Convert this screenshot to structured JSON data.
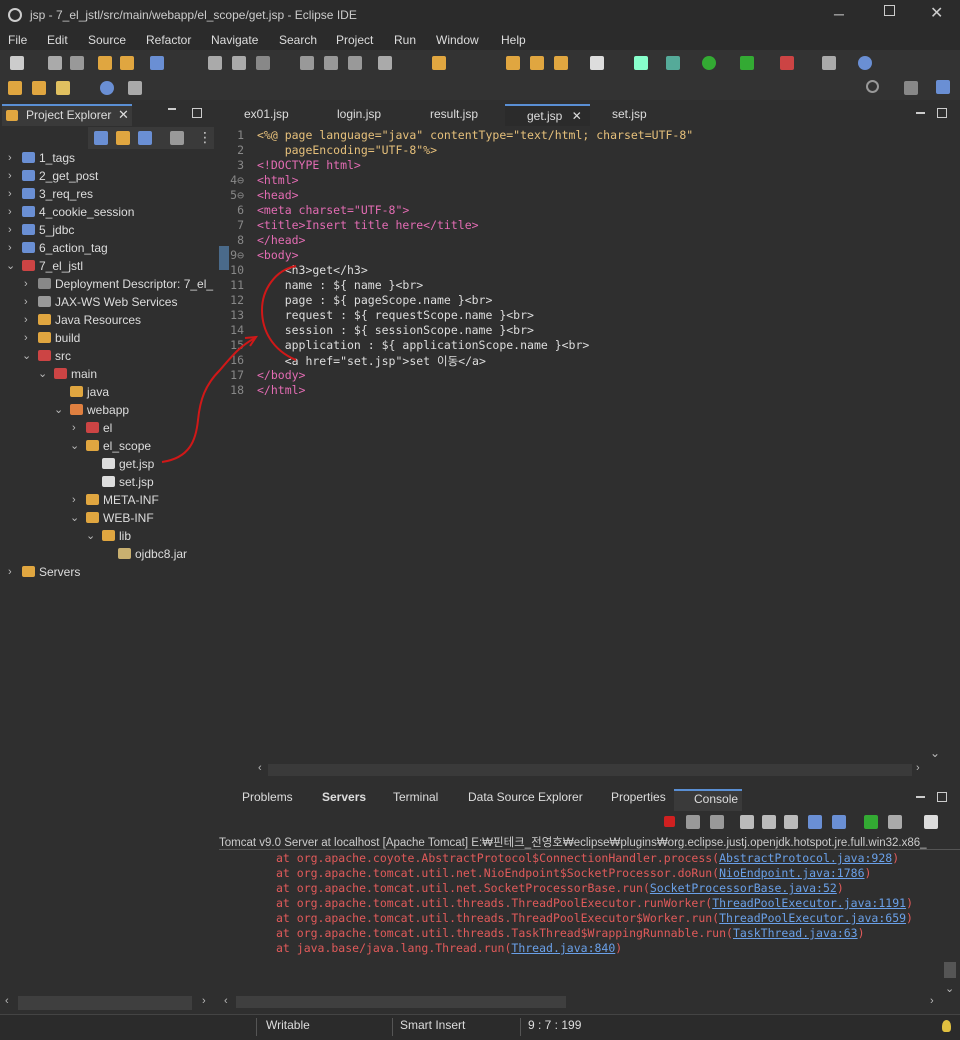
{
  "window": {
    "title": "jsp - 7_el_jstl/src/main/webapp/el_scope/get.jsp - Eclipse IDE"
  },
  "menu": [
    "File",
    "Edit",
    "Source",
    "Refactor",
    "Navigate",
    "Search",
    "Project",
    "Run",
    "Window",
    "Help"
  ],
  "explorer": {
    "title": "Project Explorer",
    "items": [
      "1_tags",
      "2_get_post",
      "3_req_res",
      "4_cookie_session",
      "5_jdbc",
      "6_action_tag",
      "7_el_jstl",
      "Deployment Descriptor: 7_el_",
      "JAX-WS Web Services",
      "Java Resources",
      "build",
      "src",
      "main",
      "java",
      "webapp",
      "el",
      "el_scope",
      "get.jsp",
      "set.jsp",
      "META-INF",
      "WEB-INF",
      "lib",
      "ojdbc8.jar",
      "Servers"
    ]
  },
  "editor": {
    "tabs": [
      "ex01.jsp",
      "login.jsp",
      "result.jsp",
      "get.jsp",
      "set.jsp"
    ],
    "active_tab": "get.jsp",
    "lines": [
      "<%@ page language=\"java\" contentType=\"text/html; charset=UTF-8\"",
      "    pageEncoding=\"UTF-8\"%>",
      "<!DOCTYPE html>",
      "<html>",
      "<head>",
      "<meta charset=\"UTF-8\">",
      "<title>Insert title here</title>",
      "</head>",
      "<body>",
      "    <h3>get</h3>",
      "    name : ${ name }<br>",
      "    page : ${ pageScope.name }<br>",
      "    request : ${ requestScope.name }<br>",
      "    session : ${ sessionScope.name }<br>",
      "    application : ${ applicationScope.name }<br>",
      "    <a href=\"set.jsp\">set 이동</a>",
      "</body>",
      "</html>"
    ]
  },
  "panel": {
    "tabs": [
      "Problems",
      "Servers",
      "Terminal",
      "Data Source Explorer",
      "Properties",
      "Console"
    ],
    "active_tab": "Console",
    "header": "Tomcat v9.0 Server at localhost [Apache Tomcat] E:₩핀테크_전영호₩eclipse₩plugins₩org.eclipse.justj.openjdk.hotspot.jre.full.win32.x86_",
    "lines": [
      {
        "text": "at org.apache.coyote.AbstractProtocol$ConnectionHandler.process(",
        "link": "AbstractProtocol.java:928",
        "end": ")"
      },
      {
        "text": "at org.apache.tomcat.util.net.NioEndpoint$SocketProcessor.doRun(",
        "link": "NioEndpoint.java:1786",
        "end": ")"
      },
      {
        "text": "at org.apache.tomcat.util.net.SocketProcessorBase.run(",
        "link": "SocketProcessorBase.java:52",
        "end": ")"
      },
      {
        "text": "at org.apache.tomcat.util.threads.ThreadPoolExecutor.runWorker(",
        "link": "ThreadPoolExecutor.java:1191",
        "end": ")"
      },
      {
        "text": "at org.apache.tomcat.util.threads.ThreadPoolExecutor$Worker.run(",
        "link": "ThreadPoolExecutor.java:659",
        "end": ")"
      },
      {
        "text": "at org.apache.tomcat.util.threads.TaskThread$WrappingRunnable.run(",
        "link": "TaskThread.java:63",
        "end": ")"
      },
      {
        "text": "at java.base/java.lang.Thread.run(",
        "link": "Thread.java:840",
        "end": ")"
      }
    ]
  },
  "status": {
    "writable": "Writable",
    "insert": "Smart Insert",
    "position": "9 : 7 : 199"
  }
}
